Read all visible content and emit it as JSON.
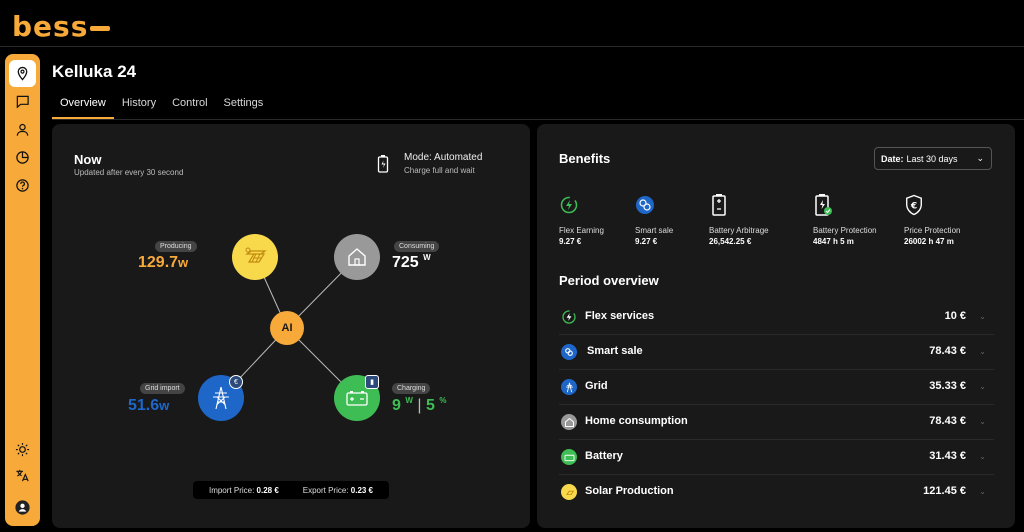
{
  "brand": {
    "logo_text": "bess",
    "accent": "#f7a93a"
  },
  "rail": {
    "top_items": [
      "location-pin-icon",
      "chat-icon",
      "user-icon",
      "pie-chart-icon",
      "help-icon"
    ],
    "bottom_items": [
      "sun-icon",
      "translate-icon",
      "account-icon"
    ]
  },
  "page": {
    "title": "Kelluka 24"
  },
  "tabs": [
    {
      "label": "Overview",
      "active": true
    },
    {
      "label": "History",
      "active": false
    },
    {
      "label": "Control",
      "active": false
    },
    {
      "label": "Settings",
      "active": false
    }
  ],
  "now": {
    "title": "Now",
    "subtitle": "Updated after every 30 second",
    "mode_title": "Mode: Automated",
    "mode_sub": "Charge full and wait",
    "producing": {
      "label": "Producing",
      "value": "129.7",
      "unit": "w"
    },
    "consuming": {
      "label": "Consuming",
      "value": "725",
      "unit": "W"
    },
    "ai_label": "AI",
    "grid": {
      "label": "Grid import",
      "value": "51.6",
      "unit": "w"
    },
    "charging": {
      "label": "Charging",
      "value": "9",
      "unit": "W",
      "sep": "|",
      "pct": "5",
      "pct_unit": "%"
    },
    "import_label": "Import Price:",
    "import_value": "0.28 €",
    "export_label": "Export Price:",
    "export_value": "0.23 €"
  },
  "benefits": {
    "title": "Benefits",
    "date_label": "Date:",
    "date_value": "Last 30 days",
    "items": [
      {
        "label": "Flex Earning",
        "value": "9.27 €",
        "icon": "flex-earning-icon"
      },
      {
        "label": "Smart sale",
        "value": "9.27 €",
        "icon": "smart-sale-icon"
      },
      {
        "label": "Battery Arbitrage",
        "value": "26,542.25 €",
        "icon": "battery-arbitrage-icon"
      },
      {
        "label": "Battery Protection",
        "value": "4847 h 5 m",
        "icon": "battery-protection-icon"
      },
      {
        "label": "Price Protection",
        "value": "26002 h 47 m",
        "icon": "price-protection-icon"
      }
    ]
  },
  "period": {
    "title": "Period overview",
    "rows": [
      {
        "label": "Flex services",
        "value": "10 €",
        "color": "#3fbd55"
      },
      {
        "label": "Smart sale",
        "value": "78.43 €",
        "color": "#1e67c8"
      },
      {
        "label": "Grid",
        "value": "35.33 €",
        "color": "#1e67c8"
      },
      {
        "label": "Home consumption",
        "value": "78.43 €",
        "color": "#999999"
      },
      {
        "label": "Battery",
        "value": "31.43 €",
        "color": "#3fbd55"
      },
      {
        "label": "Solar Production",
        "value": "121.45 €",
        "color": "#f8d94c"
      }
    ]
  }
}
